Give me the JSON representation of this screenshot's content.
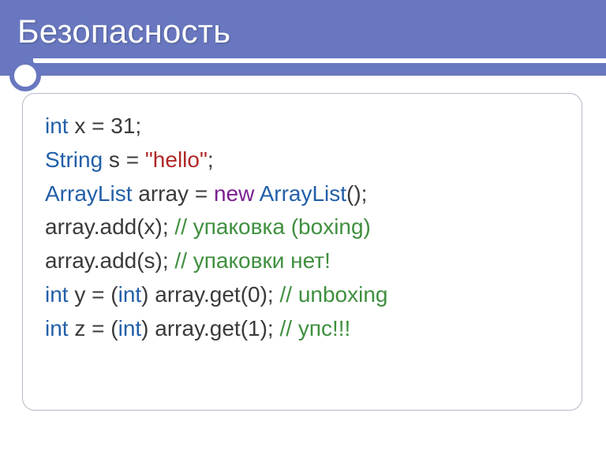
{
  "slide": {
    "title": "Безопасность"
  },
  "code": {
    "lines": [
      [
        {
          "cls": "tok-type",
          "text": "int"
        },
        {
          "cls": "tok-default",
          "text": " x = 31;"
        }
      ],
      [
        {
          "cls": "tok-type",
          "text": "String"
        },
        {
          "cls": "tok-default",
          "text": " s = "
        },
        {
          "cls": "tok-string",
          "text": "\"hello\""
        },
        {
          "cls": "tok-default",
          "text": ";"
        }
      ],
      [
        {
          "cls": "tok-type",
          "text": "ArrayList"
        },
        {
          "cls": "tok-default",
          "text": " array = "
        },
        {
          "cls": "tok-keyword",
          "text": "new"
        },
        {
          "cls": "tok-default",
          "text": " "
        },
        {
          "cls": "tok-type",
          "text": "ArrayList"
        },
        {
          "cls": "tok-default",
          "text": "();"
        }
      ],
      [
        {
          "cls": "tok-default",
          "text": "array.add(x); "
        },
        {
          "cls": "tok-comment",
          "text": "// упаковка (boxing)"
        }
      ],
      [
        {
          "cls": "tok-default",
          "text": "array.add(s); "
        },
        {
          "cls": "tok-comment",
          "text": "// упаковки нет!"
        }
      ],
      [
        {
          "cls": "tok-type",
          "text": "int"
        },
        {
          "cls": "tok-default",
          "text": " y = ("
        },
        {
          "cls": "tok-type",
          "text": "int"
        },
        {
          "cls": "tok-default",
          "text": ") array.get(0); "
        },
        {
          "cls": "tok-comment",
          "text": "// unboxing"
        }
      ],
      [
        {
          "cls": "tok-type",
          "text": "int"
        },
        {
          "cls": "tok-default",
          "text": " z = ("
        },
        {
          "cls": "tok-type",
          "text": "int"
        },
        {
          "cls": "tok-default",
          "text": ") array.get(1); "
        },
        {
          "cls": "tok-comment",
          "text": "// упс!!!"
        }
      ]
    ]
  }
}
